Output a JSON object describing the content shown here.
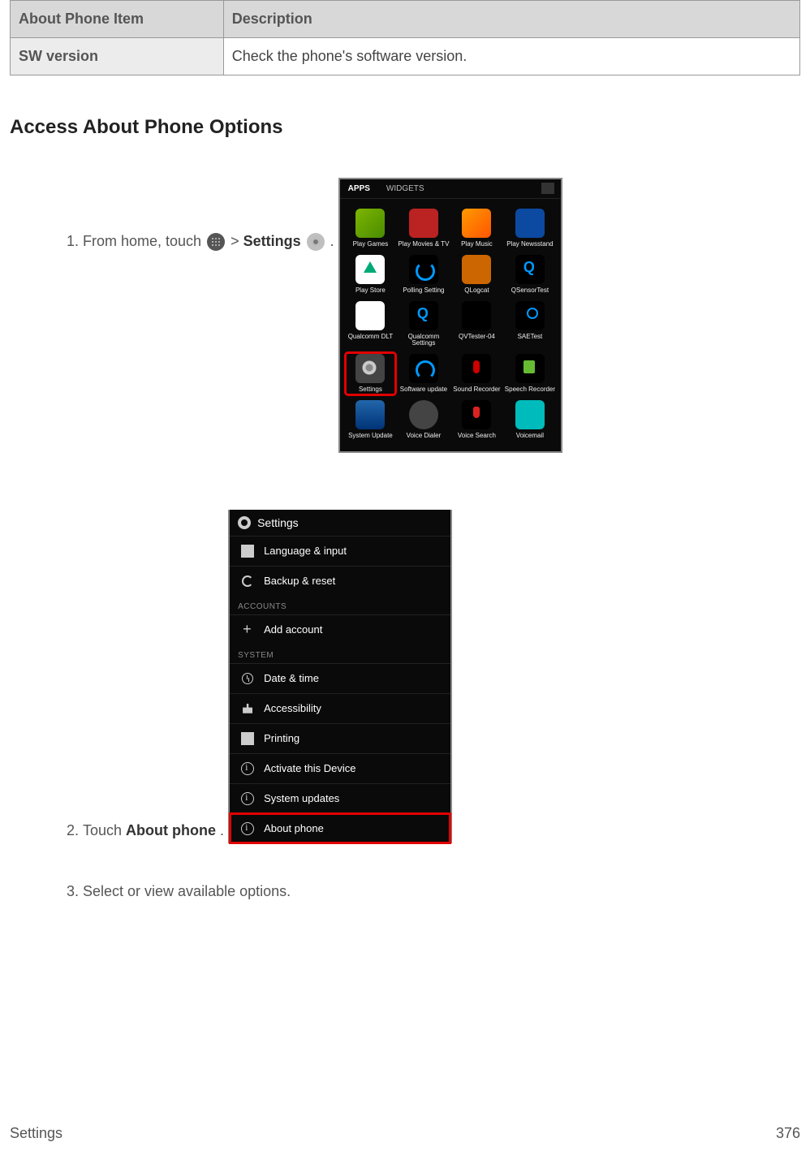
{
  "table": {
    "header_item": "About Phone Item",
    "header_desc": "Description",
    "row_label": "SW version",
    "row_desc": "Check the phone's software version."
  },
  "heading": "Access About Phone Options",
  "steps": {
    "s1_a": "From home, touch ",
    "s1_b": " > ",
    "s1_c": "Settings",
    "s1_d": " ",
    "s1_e": ".",
    "s2_a": "Touch ",
    "s2_b": "About phone",
    "s2_c": ".",
    "s3": "Select or view available options."
  },
  "shot1": {
    "tab_apps": "APPS",
    "tab_widgets": "WIDGETS",
    "apps": [
      "Play Games",
      "Play Movies & TV",
      "Play Music",
      "Play Newsstand",
      "Play Store",
      "Polling Setting",
      "QLogcat",
      "QSensorTest",
      "Qualcomm DLT",
      "Qualcomm Settings",
      "QVTester-04",
      "SAETest",
      "Settings",
      "Software update",
      "Sound Recorder",
      "Speech Recorder",
      "System Update",
      "Voice Dialer",
      "Voice Search",
      "Voicemail"
    ]
  },
  "shot2": {
    "title": "Settings",
    "rows": {
      "lang": "Language & input",
      "backup": "Backup & reset",
      "cat_accounts": "ACCOUNTS",
      "add": "Add account",
      "cat_system": "SYSTEM",
      "date": "Date & time",
      "access": "Accessibility",
      "print": "Printing",
      "activate": "Activate this Device",
      "sysupd": "System updates",
      "about": "About phone"
    }
  },
  "footer": {
    "left": "Settings",
    "right": "376"
  }
}
